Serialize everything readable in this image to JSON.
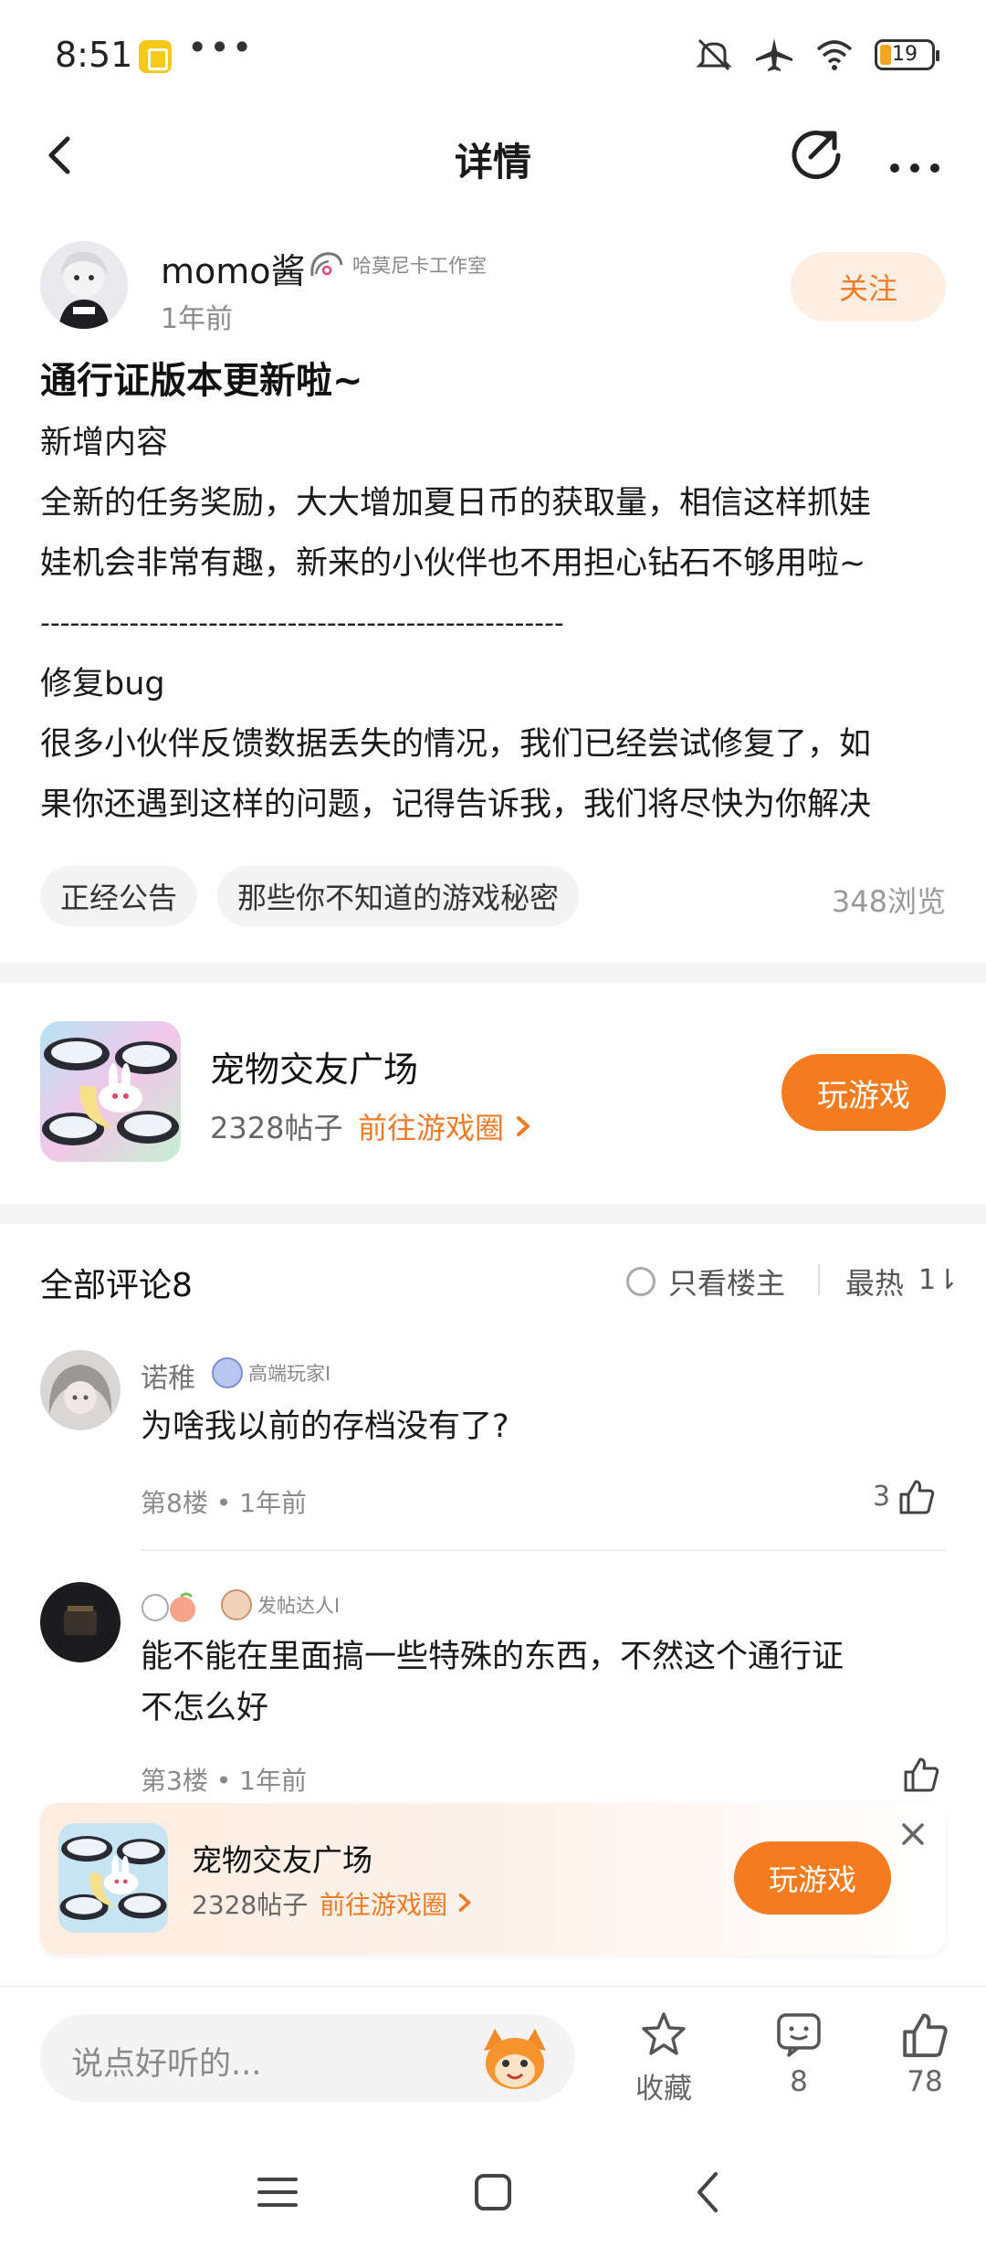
{
  "status_bar": {
    "time": "8:51",
    "dots": "•••",
    "battery": "19"
  },
  "nav": {
    "title": "详情"
  },
  "author": {
    "name": "momo酱",
    "studio": "哈莫尼卡工作室",
    "time": "1年前",
    "follow_label": "关注"
  },
  "post": {
    "title": "通行证版本更新啦~",
    "lines": [
      "新增内容",
      "全新的任务奖励，大大增加夏日币的获取量，相信这样抓娃",
      "娃机会非常有趣，新来的小伙伴也不用担心钻石不够用啦~",
      "-----------------------------------------------------",
      "修复bug",
      "很多小伙伴反馈数据丢失的情况，我们已经尝试修复了，如",
      "果你还遇到这样的问题，记得告诉我，我们将尽快为你解决"
    ],
    "tags": [
      "正经公告",
      "那些你不知道的游戏秘密"
    ],
    "views": "348浏览"
  },
  "game": {
    "name": "宠物交友广场",
    "posts": "2328帖子",
    "link": "前往游戏圈",
    "play_label": "玩游戏"
  },
  "comments_header": {
    "title": "全部评论8",
    "only_op": "只看楼主",
    "sort": "最热",
    "sort_icon": "1⇂"
  },
  "comments": [
    {
      "name": "诺稚",
      "badge": "高端玩家I",
      "text": "为啥我以前的存档没有了?",
      "meta": "第8楼 • 1年前",
      "likes": "3"
    },
    {
      "name": "",
      "badge": "发帖达人I",
      "text_lines": [
        "能不能在里面搞一些特殊的东西，不然这个通行证",
        "不怎么好"
      ],
      "meta": "第3楼 • 1年前",
      "likes": ""
    }
  ],
  "float_banner": {
    "name": "宠物交友广场",
    "posts": "2328帖子",
    "link": "前往游戏圈",
    "play_label": "玩游戏"
  },
  "bottom_bar": {
    "placeholder": "说点好听的...",
    "collect_label": "收藏",
    "comment_count": "8",
    "like_count": "78"
  },
  "colors": {
    "accent": "#f47b1e",
    "link": "#f07b26",
    "follow_bg": "#fdeee3"
  }
}
